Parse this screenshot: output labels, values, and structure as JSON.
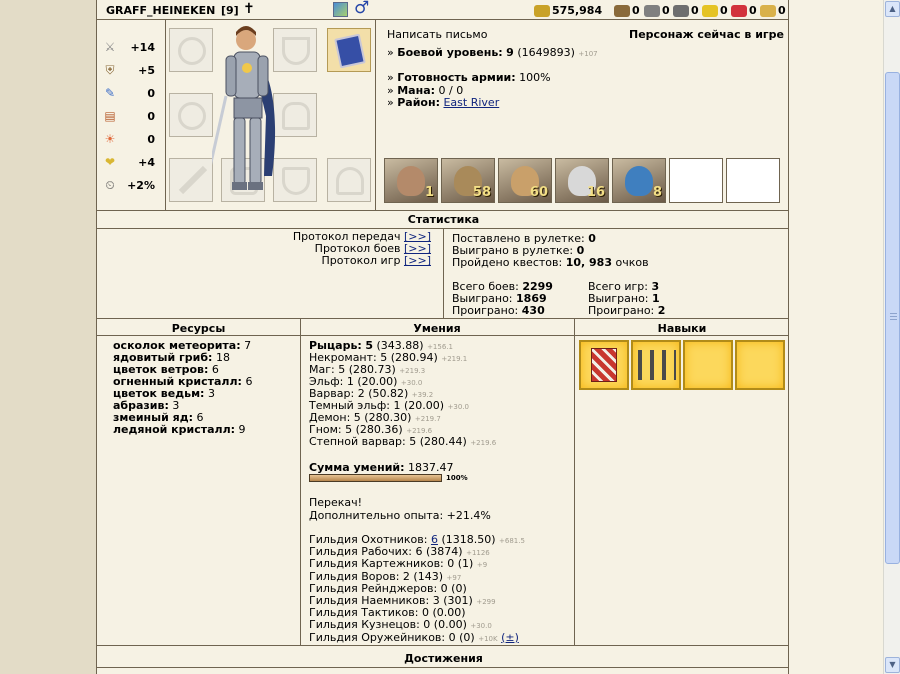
{
  "header": {
    "name": "GRAFF_HEINEKEN",
    "level": "[9]",
    "resources": [
      {
        "icon": "gold-icon",
        "value": "575,984",
        "color": "#c9a227"
      },
      {
        "icon": "wood-icon",
        "value": "0",
        "color": "#8a6a3a"
      },
      {
        "icon": "ore-icon",
        "value": "0",
        "color": "#808080"
      },
      {
        "icon": "mercury-icon",
        "value": "0",
        "color": "#6e6e6e"
      },
      {
        "icon": "sulfur-icon",
        "value": "0",
        "color": "#e5c323"
      },
      {
        "icon": "crystal-icon",
        "value": "0",
        "color": "#d2323c"
      },
      {
        "icon": "gems-icon",
        "value": "0",
        "color": "#d9b14a"
      }
    ]
  },
  "stats": [
    {
      "icon": "attack-icon",
      "value": "+14"
    },
    {
      "icon": "defense-icon",
      "value": "+5"
    },
    {
      "icon": "magic-power-icon",
      "value": "0"
    },
    {
      "icon": "knowledge-icon",
      "value": "0"
    },
    {
      "icon": "luck-icon",
      "value": "0"
    },
    {
      "icon": "morale-icon",
      "value": "+4"
    },
    {
      "icon": "initiative-icon",
      "value": "+2%"
    }
  ],
  "info": {
    "write_letter": "Написать письмо",
    "status": "Персонаж сейчас в игре",
    "combat_level_label": "Боевой уровень:",
    "combat_level_value": "9",
    "combat_level_exp": "(1649893)",
    "combat_level_extra": "+107",
    "army_ready_label": "Готовность армии:",
    "army_ready_value": "100%",
    "mana_label": "Мана:",
    "mana_value": "0 / 0",
    "district_label": "Район:",
    "district_value": "East River"
  },
  "army": [
    {
      "count": "1",
      "color": "#b48a6a"
    },
    {
      "count": "58",
      "color": "#a98a5a"
    },
    {
      "count": "60",
      "color": "#c9a06a"
    },
    {
      "count": "16",
      "color": "#d8d8d8"
    },
    {
      "count": "8",
      "color": "#3f7fbf"
    },
    {
      "count": ""
    },
    {
      "count": ""
    }
  ],
  "statistics": {
    "title": "Статистика",
    "protocols": [
      {
        "label": "Протокол передач",
        "link": "[>>]"
      },
      {
        "label": "Протокол боев",
        "link": "[>>]"
      },
      {
        "label": "Протокол игр",
        "link": "[>>]"
      }
    ],
    "roulette_bet_label": "Поставлено в рулетке:",
    "roulette_bet_value": "0",
    "roulette_won_label": "Выиграно в рулетке:",
    "roulette_won_value": "0",
    "quests_label": "Пройдено квестов:",
    "quests_value": "10, 983",
    "quests_unit": "очков",
    "battles_total_label": "Всего боев:",
    "battles_total_value": "2299",
    "battles_won_label": "Выиграно:",
    "battles_won_value": "1869",
    "battles_lost_label": "Проиграно:",
    "battles_lost_value": "430",
    "games_total_label": "Всего игр:",
    "games_total_value": "3",
    "games_won_label": "Выиграно:",
    "games_won_value": "1",
    "games_lost_label": "Проиграно:",
    "games_lost_value": "2"
  },
  "resources_section": {
    "title": "Ресурсы",
    "items": [
      {
        "name": "осколок метеорита:",
        "value": "7"
      },
      {
        "name": "ядовитый гриб:",
        "value": "18"
      },
      {
        "name": "цветок ветров:",
        "value": "6"
      },
      {
        "name": "огненный кристалл:",
        "value": "6"
      },
      {
        "name": "цветок ведьм:",
        "value": "3"
      },
      {
        "name": "абразив:",
        "value": "3"
      },
      {
        "name": "змеиный яд:",
        "value": "6"
      },
      {
        "name": "ледяной кристалл:",
        "value": "9"
      }
    ]
  },
  "skills_section": {
    "title": "Умения",
    "factions": [
      {
        "name": "Рыцарь:",
        "value": "5",
        "detail": "(343.88)",
        "extra": "+156.1",
        "bold": true
      },
      {
        "name": "Некромант:",
        "value": "5",
        "detail": "(280.94)",
        "extra": "+219.1"
      },
      {
        "name": "Маг:",
        "value": "5",
        "detail": "(280.73)",
        "extra": "+219.3"
      },
      {
        "name": "Эльф:",
        "value": "1",
        "detail": "(20.00)",
        "extra": "+30.0"
      },
      {
        "name": "Варвар:",
        "value": "2",
        "detail": "(50.82)",
        "extra": "+39.2"
      },
      {
        "name": "Темный эльф:",
        "value": "1",
        "detail": "(20.00)",
        "extra": "+30.0"
      },
      {
        "name": "Демон:",
        "value": "5",
        "detail": "(280.30)",
        "extra": "+219.7"
      },
      {
        "name": "Гном:",
        "value": "5",
        "detail": "(280.36)",
        "extra": "+219.6"
      },
      {
        "name": "Степной варвар:",
        "value": "5",
        "detail": "(280.44)",
        "extra": "+219.6"
      }
    ],
    "sum_label": "Сумма умений:",
    "sum_value": "1837.47",
    "progress_label": "100%",
    "progress": 1.0,
    "overlevel": "Перекач!",
    "extra_exp": "Дополнительно опыта: +21.4%",
    "guilds": [
      {
        "name": "Гильдия Охотников:",
        "value": "6",
        "detail": "(1318.50)",
        "extra": "+681.5",
        "link": true
      },
      {
        "name": "Гильдия Рабочих:",
        "value": "6",
        "detail": "(3874)",
        "extra": "+1126"
      },
      {
        "name": "Гильдия Картежников:",
        "value": "0",
        "detail": "(1)",
        "extra": "+9"
      },
      {
        "name": "Гильдия Воров:",
        "value": "2",
        "detail": "(143)",
        "extra": "+97"
      },
      {
        "name": "Гильдия Рейнджеров:",
        "value": "0",
        "detail": "(0)",
        "extra": ""
      },
      {
        "name": "Гильдия Наемников:",
        "value": "3",
        "detail": "(301)",
        "extra": "+299"
      },
      {
        "name": "Гильдия Тактиков:",
        "value": "0",
        "detail": "(0.00)",
        "extra": ""
      },
      {
        "name": "Гильдия Кузнецов:",
        "value": "0",
        "detail": "(0.00)",
        "extra": "+30.0"
      },
      {
        "name": "Гильдия Оружейников:",
        "value": "0",
        "detail": "(0)",
        "extra": "+10K",
        "tail": "(±)"
      }
    ]
  },
  "abilities_section": {
    "title": "Навыки"
  },
  "achievements": {
    "title": "Достижения"
  }
}
